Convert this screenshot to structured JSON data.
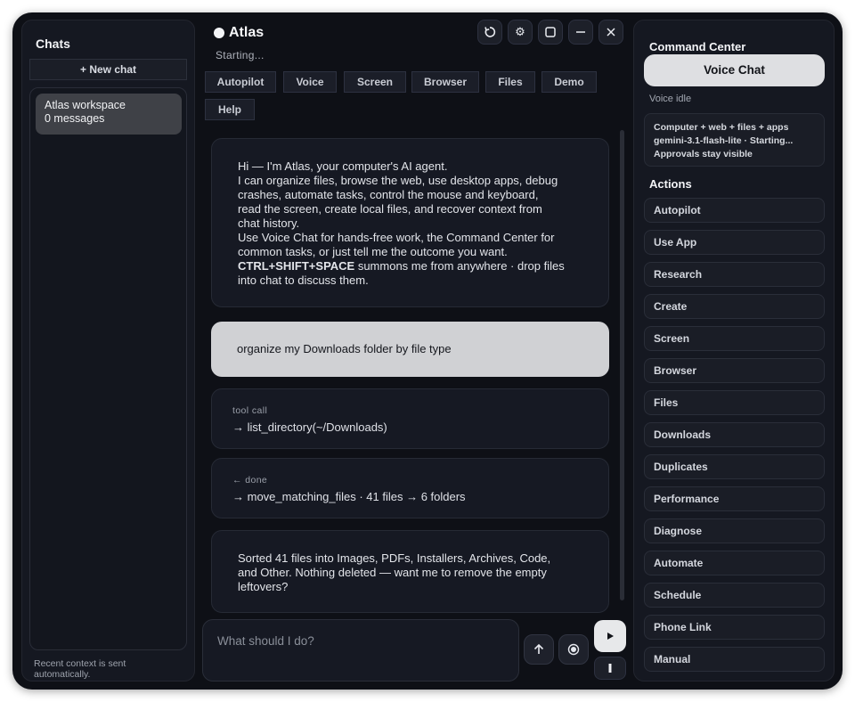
{
  "sidebar": {
    "title": "Chats",
    "new_chat": "+ New chat",
    "chats": [
      {
        "title": "Atlas workspace",
        "subtitle": "0 messages"
      }
    ],
    "footer": "Recent context is sent automatically."
  },
  "header": {
    "app_name": "Atlas",
    "status": "Starting..."
  },
  "window_controls": [
    "refresh-icon",
    "gear-icon",
    "maximize-icon",
    "minimize-icon",
    "close-icon"
  ],
  "mode_tabs": [
    "Autopilot",
    "Voice",
    "Screen",
    "Browser",
    "Files",
    "Demo",
    "Help"
  ],
  "messages": {
    "intro": [
      "Hi — I'm Atlas, your computer's AI agent.",
      "I can organize files, browse the web, use desktop apps, debug",
      "crashes, automate tasks, control the mouse and keyboard,",
      "read the screen, create local files, and recover context from",
      "chat history.",
      "Use Voice Chat for hands-free work, the Command Center for",
      "common tasks, or just tell me the outcome you want."
    ],
    "intro_shortcut": "CTRL+SHIFT+SPACE",
    "intro_shortcut_rest": " summons me from anywhere · drop files",
    "intro_last": "into chat to discuss them.",
    "user": "organize my Downloads folder by file type",
    "tool_call_label": "tool call",
    "tool_call": "→ list_directory(~/Downloads)",
    "done_label": "← done",
    "done": "→ move_matching_files · 41 files → 6 folders",
    "reply": [
      "Sorted 41 files into Images, PDFs, Installers, Archives, Code,",
      "and Other. Nothing deleted — want me to remove the empty",
      "leftovers?"
    ]
  },
  "composer": {
    "placeholder": "What should I do?"
  },
  "command_center": {
    "title": "Command Center",
    "voice_button": "Voice Chat",
    "voice_status": "Voice idle",
    "info": [
      "Computer + web + files + apps",
      "gemini-3.1-flash-lite · Starting...",
      "Approvals stay visible"
    ],
    "actions_title": "Actions",
    "actions": [
      "Autopilot",
      "Use App",
      "Research",
      "Create",
      "Screen",
      "Browser",
      "Files",
      "Downloads",
      "Duplicates",
      "Performance",
      "Diagnose",
      "Automate",
      "Schedule",
      "Phone Link",
      "Manual"
    ]
  },
  "colors": {
    "background": "#0e1016",
    "panel": "#151821",
    "user_bubble": "#d0d1d4",
    "voice_button": "#dedfe2"
  }
}
